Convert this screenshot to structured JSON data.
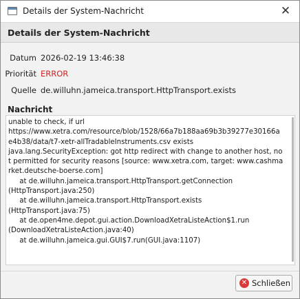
{
  "window": {
    "title": "Details der System-Nachricht"
  },
  "header": {
    "title": "Details der System-Nachricht"
  },
  "fields": {
    "date_label": "Datum",
    "date_value": "2026-02-19 13:46:38",
    "priority_label": "Priorität",
    "priority_value": "ERROR",
    "source_label": "Quelle",
    "source_value": "de.willuhn.jameica.transport.HttpTransport.exists"
  },
  "message": {
    "label": "Nachricht",
    "text": "unable to check, if url\nhttps://www.xetra.com/resource/blob/1528/66a7b188aa69b3b39277e30166ae4b38/data/t7-xetr-allTradableInstruments.csv exists\njava.lang.SecurityException: got http redirect with change to another host, not permitted for security reasons [source: www.xetra.com, target: www.cashmarket.deutsche-boerse.com]\n     at de.willuhn.jameica.transport.HttpTransport.getConnection\n(HttpTransport.java:250)\n     at de.willuhn.jameica.transport.HttpTransport.exists\n(HttpTransport.java:75)\n     at de.open4me.depot.gui.action.DownloadXetraListeAction$1.run\n(DownloadXetraListeAction.java:40)\n     at de.willuhn.jameica.gui.GUI$7.run(GUI.java:1107)"
  },
  "buttons": {
    "close_label": "Schließen"
  },
  "colors": {
    "error": "#d21f1f",
    "header_bg": "#e8e8e8",
    "close_icon": "#d93a3a"
  },
  "icons": {
    "app": "window-icon",
    "title_close": "close-icon",
    "button_close": "close-circle-icon"
  }
}
